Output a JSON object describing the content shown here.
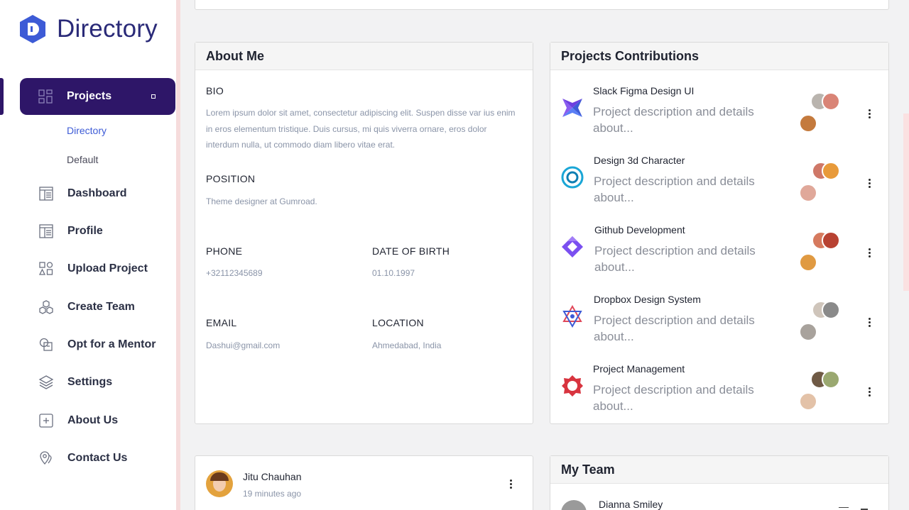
{
  "app": {
    "name": "Directory",
    "accent": "#2e1668",
    "link_color": "#3d5bd6"
  },
  "sidebar": {
    "active": {
      "label": "Projects",
      "icon": "grid-icon"
    },
    "sub_items": [
      "Directory",
      "Default"
    ],
    "items": [
      {
        "label": "Dashboard",
        "icon": "layout-icon"
      },
      {
        "label": "Profile",
        "icon": "layout-icon"
      },
      {
        "label": "Upload Project",
        "icon": "shapes-icon"
      },
      {
        "label": "Create Team",
        "icon": "cubes-icon"
      },
      {
        "label": "Opt for a Mentor",
        "icon": "mentor-icon"
      },
      {
        "label": "Settings",
        "icon": "layers-icon"
      },
      {
        "label": "About Us",
        "icon": "plus-square-icon"
      },
      {
        "label": "Contact Us",
        "icon": "location-pin-icon"
      }
    ]
  },
  "about": {
    "title": "About Me",
    "bio_label": "BIO",
    "bio": "Lorem ipsum dolor sit amet, consectetur adipiscing elit. Suspen disse var ius enim in eros elementum tristique. Duis cursus, mi quis viverra ornare, eros dolor interdum nulla, ut commodo diam libero vitae erat.",
    "position_label": "POSITION",
    "position": "Theme designer at Gumroad.",
    "phone_label": "PHONE",
    "phone": "+32112345689",
    "dob_label": "DATE OF BIRTH",
    "dob": "01.10.1997",
    "email_label": "EMAIL",
    "email": "Dashui@gmail.com",
    "location_label": "LOCATION",
    "location": "Ahmedabad, India"
  },
  "projects": {
    "title": "Projects Contributions",
    "items": [
      {
        "title": "Slack Figma Design UI",
        "desc": "Project description and details about..."
      },
      {
        "title": "Design 3d Character",
        "desc": "Project description and details about..."
      },
      {
        "title": "Github Development",
        "desc": "Project description and details about..."
      },
      {
        "title": "Dropbox Design System",
        "desc": "Project description and details about..."
      },
      {
        "title": "Project Management",
        "desc": "Project description and details about..."
      }
    ]
  },
  "post": {
    "author": "Jitu Chauhan",
    "time": "19 minutes ago"
  },
  "team": {
    "title": "My Team",
    "member": "Dianna Smiley"
  }
}
